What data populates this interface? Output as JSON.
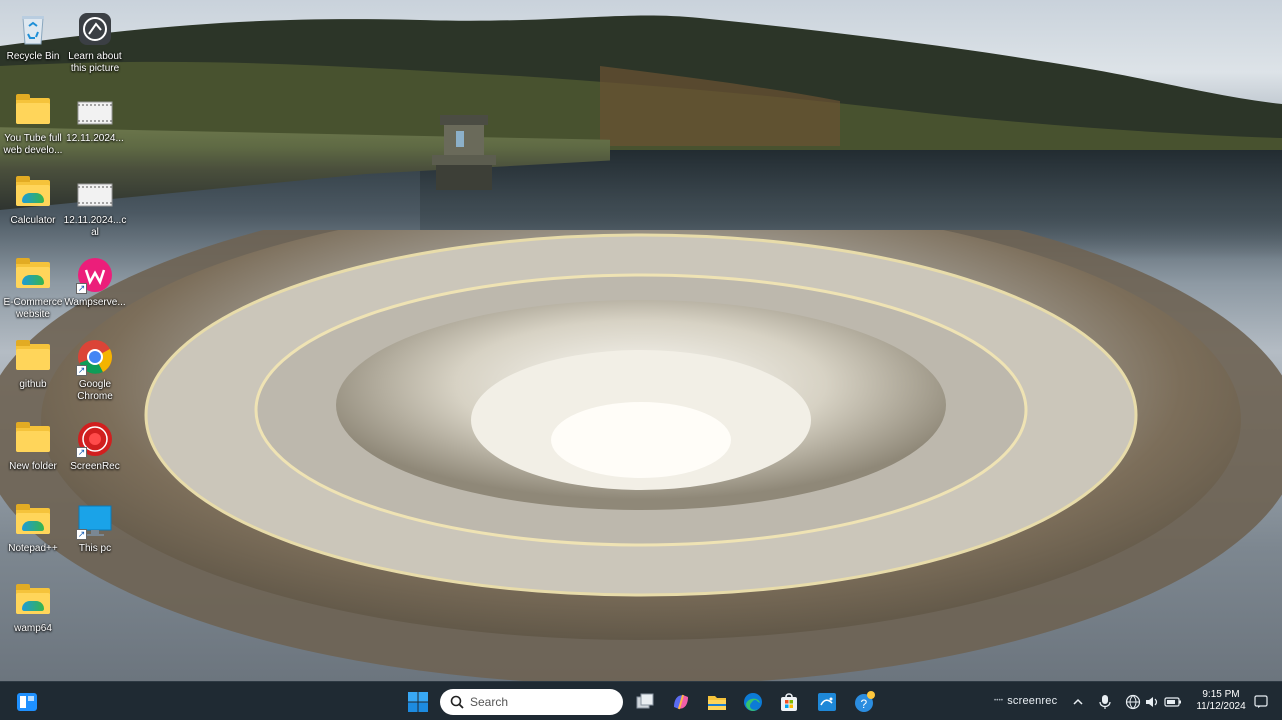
{
  "desktop": {
    "icons": [
      {
        "name": "recycle-bin",
        "label": "Recycle Bin",
        "type": "recycle"
      },
      {
        "name": "learn-about-picture",
        "label": "Learn about this picture",
        "type": "camera"
      },
      {
        "name": "youtube-web-folder",
        "label": "You Tube full web develo...",
        "type": "folder"
      },
      {
        "name": "file-12-11-2024",
        "label": "12.11.2024...",
        "type": "file"
      },
      {
        "name": "calculator-folder",
        "label": "Calculator",
        "type": "folder-color"
      },
      {
        "name": "file-12-11-2024-cal",
        "label": "12.11.2024...cal",
        "type": "file"
      },
      {
        "name": "ecommerce-website-folder",
        "label": "E-Commerce website",
        "type": "folder-color"
      },
      {
        "name": "wampserver-shortcut",
        "label": "Wampserve...",
        "type": "wamp"
      },
      {
        "name": "github-folder",
        "label": "github",
        "type": "folder"
      },
      {
        "name": "google-chrome-shortcut",
        "label": "Google Chrome",
        "type": "chrome"
      },
      {
        "name": "new-folder",
        "label": "New folder",
        "type": "folder"
      },
      {
        "name": "screenrec-shortcut",
        "label": "ScreenRec",
        "type": "screenrec"
      },
      {
        "name": "notepad-plus-plus-folder",
        "label": "Notepad++",
        "type": "folder-color"
      },
      {
        "name": "this-pc-shortcut",
        "label": "This pc",
        "type": "thispc"
      },
      {
        "name": "wamp64-folder",
        "label": "wamp64",
        "type": "folder-color"
      }
    ]
  },
  "taskbar": {
    "search": {
      "placeholder": "Search"
    },
    "apps": [
      {
        "name": "task-view",
        "icon": "task-view-icon"
      },
      {
        "name": "copilot",
        "icon": "copilot-icon"
      },
      {
        "name": "file-explorer",
        "icon": "folder-icon"
      },
      {
        "name": "edge",
        "icon": "edge-icon"
      },
      {
        "name": "microsoft-store",
        "icon": "store-icon"
      },
      {
        "name": "mysql-workbench",
        "icon": "mysql-icon"
      },
      {
        "name": "get-help",
        "icon": "help-icon"
      }
    ],
    "tray": {
      "brand": "screenrec",
      "time": "9:15 PM",
      "date": "11/12/2024"
    }
  },
  "colors": {
    "taskbar_bg": "#1f2a33",
    "folder_yellow": "#f5c33b",
    "windows_blue": "#1e90ff"
  }
}
